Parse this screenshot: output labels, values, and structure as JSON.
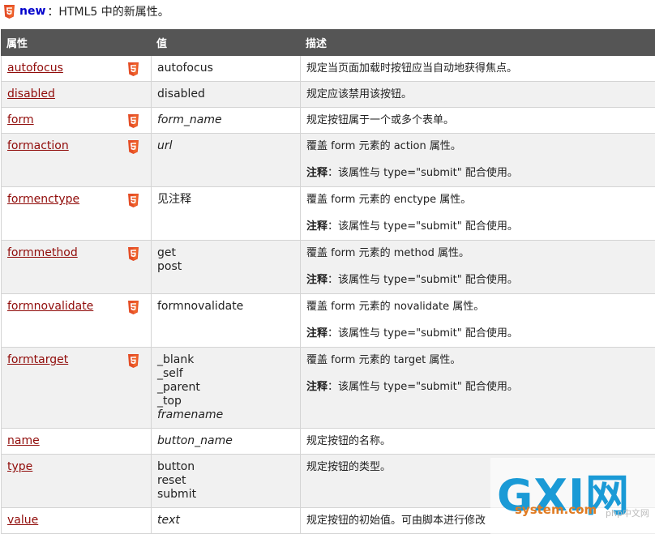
{
  "legend": {
    "badge_icon": "html5-icon",
    "new_label": "new",
    "text": "：HTML5 中的新属性。"
  },
  "table": {
    "headers": [
      "属性",
      "值",
      "描述"
    ],
    "rows": [
      {
        "attr": "autofocus",
        "html5": true,
        "values": [
          {
            "text": "autofocus",
            "italic": false
          }
        ],
        "desc": "规定当页面加载时按钮应当自动地获得焦点。",
        "note": ""
      },
      {
        "attr": "disabled",
        "html5": false,
        "values": [
          {
            "text": "disabled",
            "italic": false
          }
        ],
        "desc": "规定应该禁用该按钮。",
        "note": ""
      },
      {
        "attr": "form",
        "html5": true,
        "values": [
          {
            "text": "form_name",
            "italic": true
          }
        ],
        "desc": "规定按钮属于一个或多个表单。",
        "note": ""
      },
      {
        "attr": "formaction",
        "html5": true,
        "values": [
          {
            "text": "url",
            "italic": true
          }
        ],
        "desc": "覆盖 form 元素的 action 属性。",
        "note": "该属性与 type=\"submit\" 配合使用。"
      },
      {
        "attr": "formenctype",
        "html5": true,
        "values": [
          {
            "text": "见注释",
            "italic": false
          }
        ],
        "desc": "覆盖 form 元素的 enctype 属性。",
        "note": "该属性与 type=\"submit\" 配合使用。"
      },
      {
        "attr": "formmethod",
        "html5": true,
        "values": [
          {
            "text": "get",
            "italic": false
          },
          {
            "text": "post",
            "italic": false
          }
        ],
        "desc": "覆盖 form 元素的 method 属性。",
        "note": "该属性与 type=\"submit\" 配合使用。"
      },
      {
        "attr": "formnovalidate",
        "html5": true,
        "values": [
          {
            "text": "formnovalidate",
            "italic": false
          }
        ],
        "desc": "覆盖 form 元素的 novalidate 属性。",
        "note": "该属性与 type=\"submit\" 配合使用。"
      },
      {
        "attr": "formtarget",
        "html5": true,
        "values": [
          {
            "text": "_blank",
            "italic": false
          },
          {
            "text": "_self",
            "italic": false
          },
          {
            "text": "_parent",
            "italic": false
          },
          {
            "text": "_top",
            "italic": false
          },
          {
            "text": "framename",
            "italic": true
          }
        ],
        "desc": "覆盖 form 元素的 target 属性。",
        "note": "该属性与 type=\"submit\" 配合使用。"
      },
      {
        "attr": "name",
        "html5": false,
        "values": [
          {
            "text": "button_name",
            "italic": true
          }
        ],
        "desc": "规定按钮的名称。",
        "note": ""
      },
      {
        "attr": "type",
        "html5": false,
        "values": [
          {
            "text": "button",
            "italic": false
          },
          {
            "text": "reset",
            "italic": false
          },
          {
            "text": "submit",
            "italic": false
          }
        ],
        "desc": "规定按钮的类型。",
        "note": ""
      },
      {
        "attr": "value",
        "html5": false,
        "values": [
          {
            "text": "text",
            "italic": true
          }
        ],
        "desc": "规定按钮的初始值。可由脚本进行修改",
        "note": ""
      }
    ],
    "note_label": "注释"
  },
  "watermark": {
    "logo": "GXI网",
    "site": "system.com",
    "sub": "php中文网"
  },
  "colors": {
    "header_bg": "#555555",
    "link": "#900b09",
    "new_label": "#0000cc",
    "html5_badge": "#e44d26"
  }
}
